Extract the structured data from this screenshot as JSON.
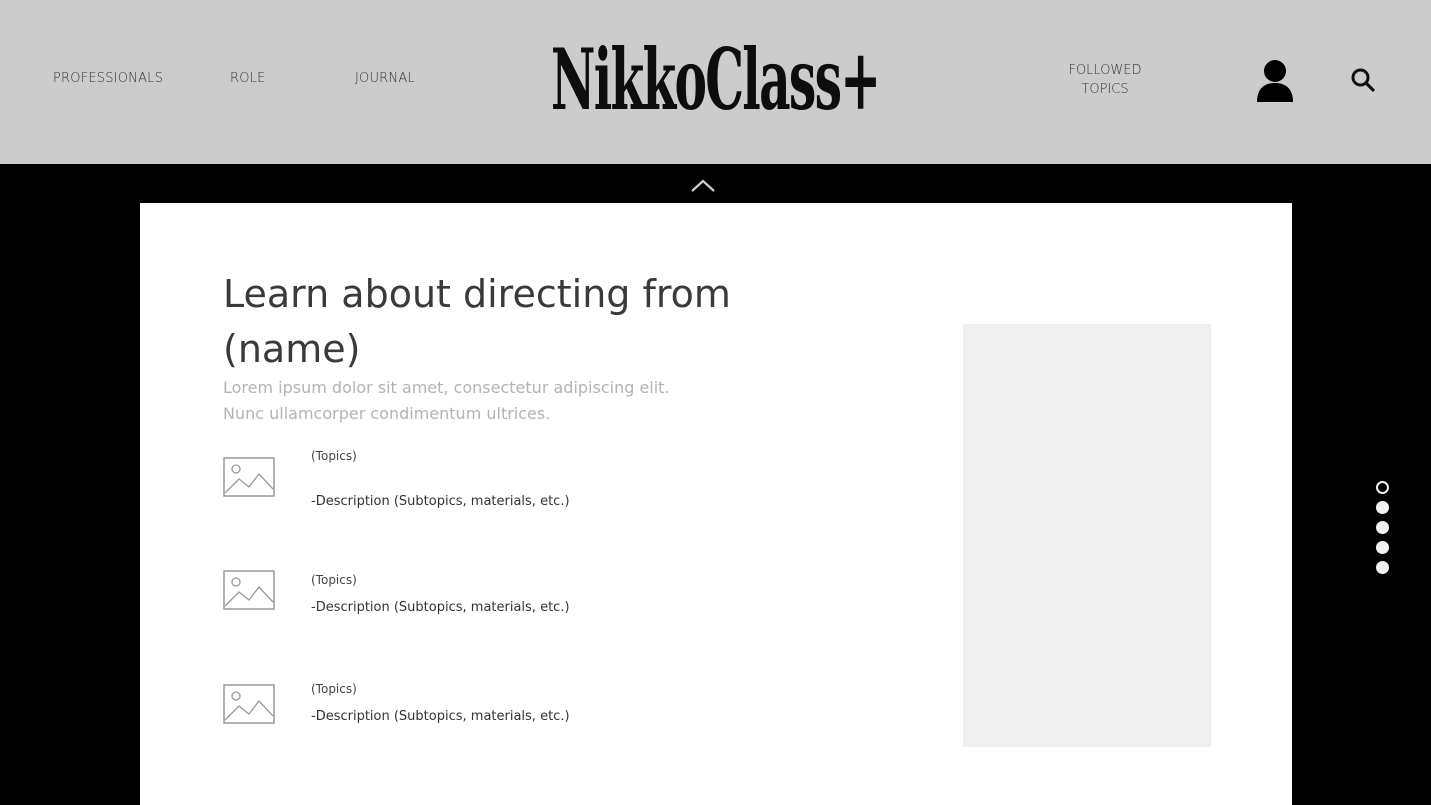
{
  "header": {
    "nav": [
      {
        "label": "PROFESSIONALS"
      },
      {
        "label": "ROLE"
      },
      {
        "label": "JOURNAL"
      }
    ],
    "logo": "NikkoClass+",
    "followed_topics": {
      "line1": "FOLLOWED",
      "line2": "TOPICS"
    },
    "icons": {
      "user": "user-icon",
      "search": "search-icon"
    }
  },
  "main": {
    "title": "Learn about directing from (name)",
    "subtitle_line1": "Lorem ipsum dolor sit amet, consectetur adipiscing elit.",
    "subtitle_line2": "Nunc ullamcorper condimentum ultrices.",
    "topics": [
      {
        "label": "(Topics)",
        "description": "-Description (Subtopics, materials, etc.)"
      },
      {
        "label": "(Topics)",
        "description": "-Description (Subtopics, materials, etc.)"
      },
      {
        "label": "(Topics)",
        "description": "-Description (Subtopics, materials, etc.)"
      }
    ]
  },
  "pager": {
    "count": 5,
    "active_index": 0
  },
  "colors": {
    "header_bg": "#cccccc",
    "page_bg": "#000000",
    "card_bg": "#ffffff",
    "panel_bg": "#f0f0f0"
  }
}
